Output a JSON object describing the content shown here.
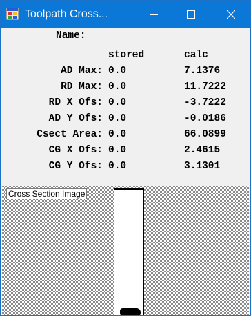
{
  "window": {
    "title": "Toolpath Cross..."
  },
  "name_label": "Name:",
  "headers": {
    "stored": "stored",
    "calc": "calc"
  },
  "rows": [
    {
      "label": "AD Max:",
      "stored": "0.0",
      "calc": "7.1376"
    },
    {
      "label": "RD Max:",
      "stored": "0.0",
      "calc": "11.7222"
    },
    {
      "label": "RD X Ofs:",
      "stored": "0.0",
      "calc": "-3.7222"
    },
    {
      "label": "AD Y Ofs:",
      "stored": "0.0",
      "calc": "-0.0186"
    },
    {
      "label": "Csect Area:",
      "stored": "0.0",
      "calc": "66.0899"
    },
    {
      "label": "CG X Ofs:",
      "stored": "0.0",
      "calc": "2.4615"
    },
    {
      "label": "CG Y Ofs:",
      "stored": "0.0",
      "calc": "3.1301"
    }
  ],
  "image_panel": {
    "label": "Cross Section Image"
  },
  "colors": {
    "titlebar": "#0b78d7",
    "client": "#f0f0f0"
  },
  "icons": [
    "app-window-icon",
    "minimize-icon",
    "maximize-icon",
    "close-icon"
  ]
}
